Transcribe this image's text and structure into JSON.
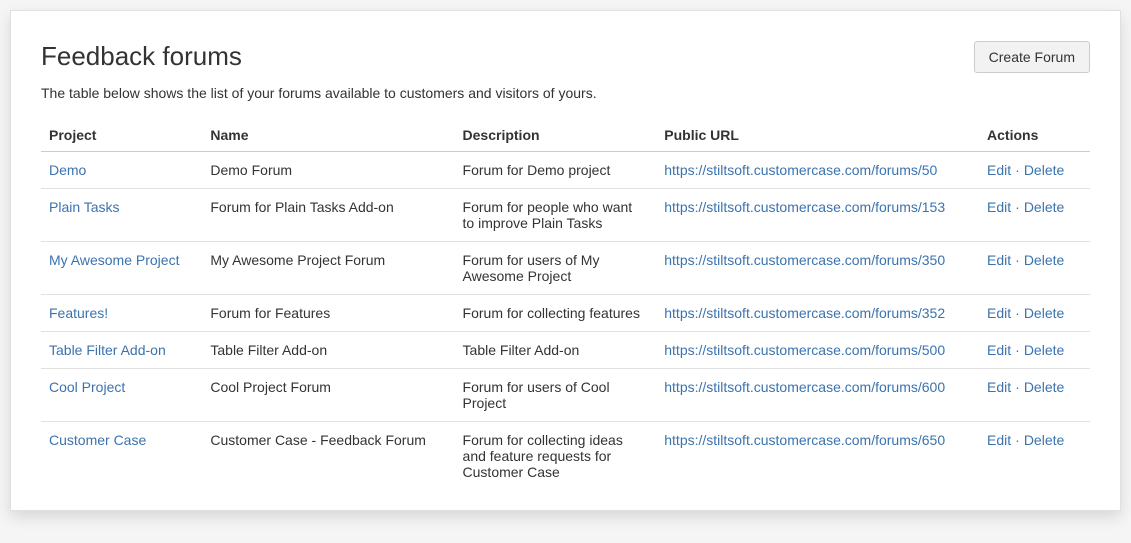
{
  "header": {
    "title": "Feedback forums",
    "create_button": "Create Forum"
  },
  "intro": "The table below shows the list of your forums available to customers and visitors of yours.",
  "table": {
    "headers": {
      "project": "Project",
      "name": "Name",
      "description": "Description",
      "public_url": "Public URL",
      "actions": "Actions"
    },
    "action_labels": {
      "edit": "Edit",
      "delete": "Delete",
      "separator": "·"
    },
    "rows": [
      {
        "project": "Demo",
        "name": "Demo Forum",
        "description": "Forum for Demo project",
        "url": "https://stiltsoft.customercase.com/forums/50"
      },
      {
        "project": "Plain Tasks",
        "name": "Forum for Plain Tasks Add-on",
        "description": "Forum for people who want to improve Plain Tasks",
        "url": "https://stiltsoft.customercase.com/forums/153"
      },
      {
        "project": "My Awesome Project",
        "name": "My Awesome Project Forum",
        "description": "Forum for users of My Awesome Project",
        "url": "https://stiltsoft.customercase.com/forums/350"
      },
      {
        "project": "Features!",
        "name": "Forum for Features",
        "description": "Forum for collecting features",
        "url": "https://stiltsoft.customercase.com/forums/352"
      },
      {
        "project": "Table Filter Add-on",
        "name": "Table Filter Add-on",
        "description": "Table Filter Add-on",
        "url": "https://stiltsoft.customercase.com/forums/500"
      },
      {
        "project": "Cool Project",
        "name": "Cool Project Forum",
        "description": "Forum for users of Cool Project",
        "url": "https://stiltsoft.customercase.com/forums/600"
      },
      {
        "project": "Customer Case",
        "name": "Customer Case - Feedback Forum",
        "description": "Forum for collecting ideas and feature requests for Customer Case",
        "url": "https://stiltsoft.customercase.com/forums/650"
      }
    ]
  }
}
